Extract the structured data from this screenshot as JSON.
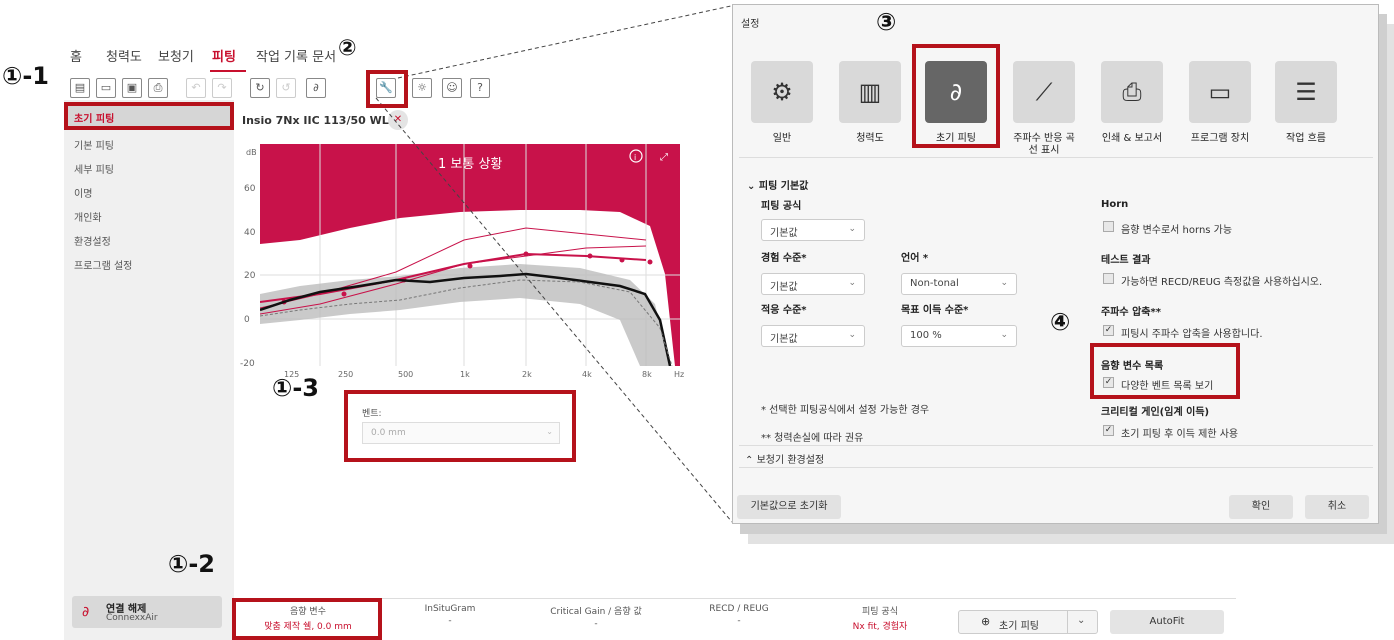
{
  "menu": {
    "home": "홈",
    "audiogram": "청력도",
    "hearing_aid": "보청기",
    "fitting": "피팅",
    "work_log": "작업 기록 문서"
  },
  "callouts": {
    "c1_1": "①-1",
    "c1_2": "①-2",
    "c1_3": "①-3",
    "c2": "②",
    "c3": "③",
    "c4": "④"
  },
  "sidebar": {
    "items": [
      "초기 피팅",
      "기본 피팅",
      "세부 피팅",
      "이명",
      "개인화",
      "환경설정",
      "프로그램 설정"
    ],
    "disconnect_label": "연결 해제",
    "disconnect_sub": "ConnexxAir"
  },
  "device": {
    "name": "Insio 7Nx IIC 113/50 WL"
  },
  "chart_data": {
    "type": "line",
    "title": "1 보통 상황",
    "ylabel": "dB",
    "xunit": "Hz",
    "y_ticks": [
      "60",
      "40",
      "20",
      "0",
      "-20"
    ],
    "x_ticks": [
      "125",
      "250",
      "500",
      "1k",
      "2k",
      "4k",
      "8k"
    ],
    "ylim": [
      -20,
      75
    ]
  },
  "vent": {
    "label": "벤트:",
    "value": "0.0 mm"
  },
  "bottom_tabs": [
    {
      "label": "음향 변수",
      "value": "맞춤 제작 쉘, 0.0 mm"
    },
    {
      "label": "InSituGram",
      "value": "-"
    },
    {
      "label": "Critical Gain / 음향 값",
      "value": "-"
    },
    {
      "label": "RECD / REUG",
      "value": "-"
    },
    {
      "label": "피팅 공식",
      "value": "Nx fit, 경험자"
    }
  ],
  "bottom_buttons": {
    "first_fit": "초기 피팅",
    "autofit": "AutoFit"
  },
  "dialog": {
    "title": "설정",
    "categories": [
      "일반",
      "청력도",
      "초기 피팅",
      "주파수 반응 곡선 표시",
      "인쇄 & 보고서",
      "프로그램 장치",
      "작업 흐름"
    ],
    "section_title": "피팅 기본값",
    "formula_label": "피팅 공식",
    "formula_value": "기본값",
    "experience_label": "경험 수준*",
    "experience_value": "기본값",
    "language_label": "언어 *",
    "language_value": "Non-tonal",
    "adaptation_label": "적응 수준*",
    "adaptation_value": "기본값",
    "target_gain_label": "목표 이득 수준*",
    "target_gain_value": "100 %",
    "horn_title": "Horn",
    "horn_option": "음향 변수로서 horns 가능",
    "test_title": "테스트 결과",
    "test_option": "가능하면 RECD/REUG 측정값을 사용하십시오.",
    "freq_title": "주파수 압축**",
    "freq_option": "피팅시 주파수 압축을 사용합니다.",
    "acoustic_title": "음향 변수 목록",
    "acoustic_option": "다양한 벤트 목록 보기",
    "critical_title": "크리티컬 게인(임계 이득)",
    "critical_option": "초기 피팅 후 이득 제한 사용",
    "note1": "* 선택한 피팅공식에서 설정 가능한 경우",
    "note2": "** 청력손실에 따라 권유",
    "env_section": "보청기 환경설정",
    "reset_button": "기본값으로 초기화",
    "ok_button": "확인",
    "cancel_button": "취소"
  }
}
